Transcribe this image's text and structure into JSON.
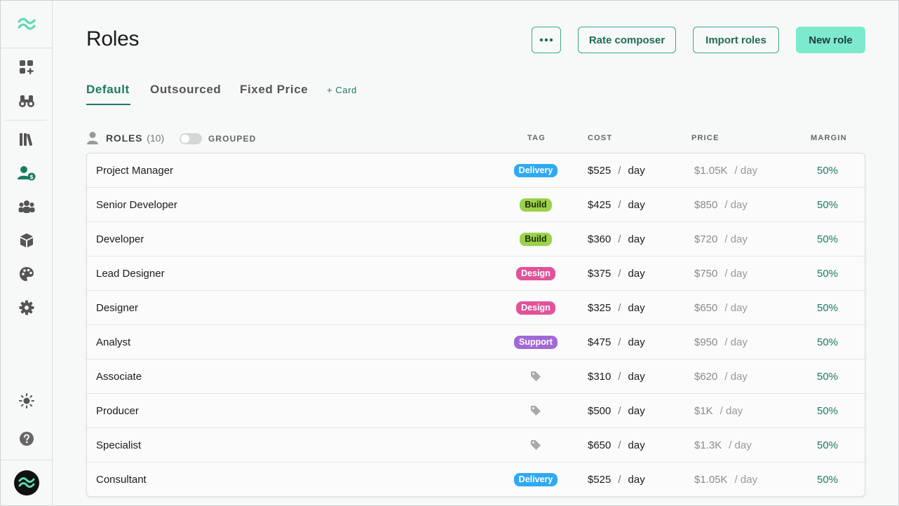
{
  "header": {
    "title": "Roles",
    "more_label": "•••",
    "rate_composer_label": "Rate composer",
    "import_roles_label": "Import roles",
    "new_role_label": "New role"
  },
  "tabs": [
    {
      "label": "Default",
      "active": true
    },
    {
      "label": "Outsourced",
      "active": false
    },
    {
      "label": "Fixed Price",
      "active": false
    }
  ],
  "add_card_label": "+ Card",
  "table_header": {
    "roles_label": "ROLES",
    "roles_count": "(10)",
    "grouped_label": "GROUPED",
    "tag": "TAG",
    "cost": "COST",
    "price": "PRICE",
    "margin": "MARGIN"
  },
  "tag_colors": {
    "Delivery": {
      "bg": "#2fa9f2",
      "fg": "#ffffff"
    },
    "Build": {
      "bg": "#9bd24a",
      "fg": "#1c2a0a"
    },
    "Design": {
      "bg": "#e0539a",
      "fg": "#ffffff"
    },
    "Support": {
      "bg": "#a06ad6",
      "fg": "#ffffff"
    }
  },
  "rows": [
    {
      "name": "Project Manager",
      "tag": "Delivery",
      "cost": "$525",
      "cost_unit": "day",
      "price": "$1.05K",
      "price_unit": "/ day",
      "margin": "50%"
    },
    {
      "name": "Senior Developer",
      "tag": "Build",
      "cost": "$425",
      "cost_unit": "day",
      "price": "$850",
      "price_unit": "/ day",
      "margin": "50%"
    },
    {
      "name": "Developer",
      "tag": "Build",
      "cost": "$360",
      "cost_unit": "day",
      "price": "$720",
      "price_unit": "/ day",
      "margin": "50%"
    },
    {
      "name": "Lead Designer",
      "tag": "Design",
      "cost": "$375",
      "cost_unit": "day",
      "price": "$750",
      "price_unit": "/ day",
      "margin": "50%"
    },
    {
      "name": "Designer",
      "tag": "Design",
      "cost": "$325",
      "cost_unit": "day",
      "price": "$650",
      "price_unit": "/ day",
      "margin": "50%"
    },
    {
      "name": "Analyst",
      "tag": "Support",
      "cost": "$475",
      "cost_unit": "day",
      "price": "$950",
      "price_unit": "/ day",
      "margin": "50%"
    },
    {
      "name": "Associate",
      "tag": "",
      "cost": "$310",
      "cost_unit": "day",
      "price": "$620",
      "price_unit": "/ day",
      "margin": "50%"
    },
    {
      "name": "Producer",
      "tag": "",
      "cost": "$500",
      "cost_unit": "day",
      "price": "$1K",
      "price_unit": "/ day",
      "margin": "50%"
    },
    {
      "name": "Specialist",
      "tag": "",
      "cost": "$650",
      "cost_unit": "day",
      "price": "$1.3K",
      "price_unit": "/ day",
      "margin": "50%"
    },
    {
      "name": "Consultant",
      "tag": "Delivery",
      "cost": "$525",
      "cost_unit": "day",
      "price": "$1.05K",
      "price_unit": "/ day",
      "margin": "50%"
    }
  ],
  "sidebar": {
    "icons": [
      "logo-icon",
      "dashboard-add-icon",
      "binoculars-icon",
      "library-icon",
      "user-rates-icon",
      "team-icon",
      "package-icon",
      "palette-icon",
      "settings-icon",
      "theme-sun-icon",
      "help-icon"
    ],
    "accent": "#1a7a62",
    "brand": "#5ed9b5"
  }
}
